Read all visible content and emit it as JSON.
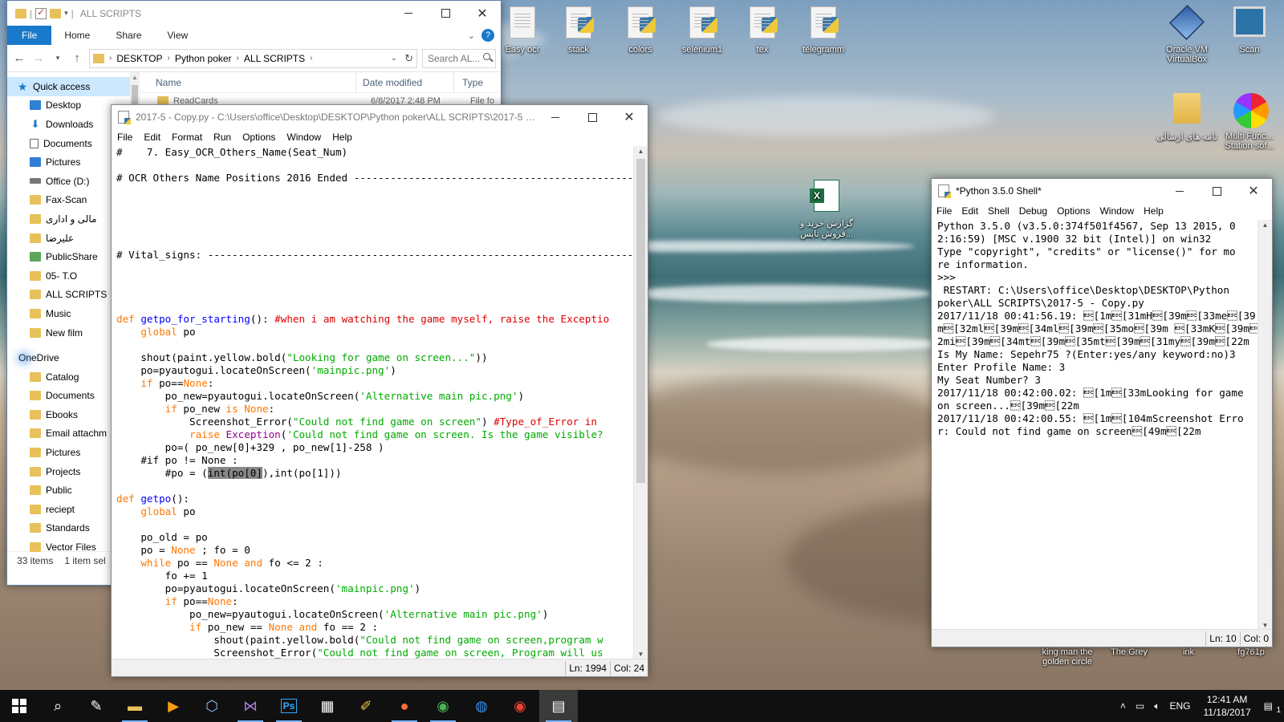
{
  "desktop": {
    "icons_top": [
      {
        "label": "Easy ocr"
      },
      {
        "label": "stack"
      },
      {
        "label": "colors"
      },
      {
        "label": "selenium1"
      },
      {
        "label": "tex"
      },
      {
        "label": "telegramm"
      }
    ],
    "icons_right": [
      {
        "label": "Oracle VM VirtualBox"
      },
      {
        "label": "Scan"
      },
      {
        "label": "نامه های ارسالی"
      },
      {
        "label": "Multi Func... Station sof..."
      }
    ],
    "excel_icon_label": "گزارش خرید و فروش تایس...",
    "bottom_labels": [
      "king man the golden circle",
      "The Grey",
      "ink",
      "fg761p"
    ]
  },
  "explorer": {
    "title": "ALL SCRIPTS",
    "tabs": [
      "File",
      "Home",
      "Share",
      "View"
    ],
    "breadcrumb": [
      "DESKTOP",
      "Python poker",
      "ALL SCRIPTS"
    ],
    "search_placeholder": "Search AL...",
    "columns": [
      "Name",
      "Date modified",
      "Type"
    ],
    "partial_row": {
      "name": "ReadCards",
      "date": "6/8/2017 2:48 PM",
      "type": "File fo"
    },
    "nav_items": [
      {
        "label": "Quick access",
        "icon": "star-icon"
      },
      {
        "label": "Desktop",
        "icon": "desktop-icon"
      },
      {
        "label": "Downloads",
        "icon": "download-icon"
      },
      {
        "label": "Documents",
        "icon": "document-icon"
      },
      {
        "label": "Pictures",
        "icon": "pictures-icon"
      },
      {
        "label": "Office (D:)",
        "icon": "drive-icon"
      },
      {
        "label": "Fax-Scan",
        "icon": "folder-icon"
      },
      {
        "label": "مالی و اداری",
        "icon": "folder-icon"
      },
      {
        "label": "علیرضا",
        "icon": "folder-icon"
      },
      {
        "label": "PublicShare",
        "icon": "shared-folder-icon"
      },
      {
        "label": "05- T.O",
        "icon": "folder-icon"
      },
      {
        "label": "ALL SCRIPTS",
        "icon": "folder-icon"
      },
      {
        "label": "Music",
        "icon": "folder-icon"
      },
      {
        "label": "New film",
        "icon": "folder-icon"
      },
      {
        "label": "OneDrive",
        "icon": "cloud-icon"
      },
      {
        "label": "Catalog",
        "icon": "folder-icon"
      },
      {
        "label": "Documents",
        "icon": "folder-icon"
      },
      {
        "label": "Ebooks",
        "icon": "folder-icon"
      },
      {
        "label": "Email attachm",
        "icon": "folder-icon"
      },
      {
        "label": "Pictures",
        "icon": "folder-icon"
      },
      {
        "label": "Projects",
        "icon": "folder-icon"
      },
      {
        "label": "Public",
        "icon": "folder-icon"
      },
      {
        "label": "reciept",
        "icon": "folder-icon"
      },
      {
        "label": "Standards",
        "icon": "folder-icon"
      },
      {
        "label": "Vector Files",
        "icon": "folder-icon"
      }
    ],
    "status_items": "33 items",
    "status_selected": "1 item sel"
  },
  "editor": {
    "title": "2017-5 - Copy.py - C:\\Users\\office\\Desktop\\DESKTOP\\Python poker\\ALL SCRIPTS\\2017-5 - C...",
    "menu": [
      "File",
      "Edit",
      "Format",
      "Run",
      "Options",
      "Window",
      "Help"
    ],
    "status_line": "Ln: 1994",
    "status_col": "Col: 24"
  },
  "shell": {
    "title": "*Python 3.5.0 Shell*",
    "menu": [
      "File",
      "Edit",
      "Shell",
      "Debug",
      "Options",
      "Window",
      "Help"
    ],
    "status_line": "Ln: 10",
    "status_col": "Col: 0",
    "lines": [
      {
        "text": "Python 3.5.0 (v3.5.0:374f501f4567, Sep 13 2015, 0",
        "style": "plain"
      },
      {
        "text": "2:16:59) [MSC v.1900 32 bit (Intel)] on win32",
        "style": "plain"
      },
      {
        "text": "Type \"copyright\", \"credits\" or \"license()\" for mo",
        "style": "plain"
      },
      {
        "text": "re information.",
        "style": "plain"
      },
      {
        "text": ">>> ",
        "style": "prompt"
      },
      {
        "text": " RESTART: C:\\Users\\office\\Desktop\\DESKTOP\\Python",
        "style": "plain"
      },
      {
        "text": "poker\\ALL SCRIPTS\\2017-5 - Copy.py",
        "style": "plain"
      },
      {
        "text": "2017/11/18 00:41:56.19: \u001b[1m\u001b[31mH\u001b[39m\u001b[33me\u001b[39",
        "style": "blue"
      },
      {
        "text": "m\u001b[32ml\u001b[39m\u001b[34ml\u001b[39m\u001b[35mo\u001b[39m \u001b[33mK\u001b[39m\u001b[3",
        "style": "blue"
      },
      {
        "text": "2mi\u001b[39m\u001b[34mt\u001b[39m\u001b[35mt\u001b[39m\u001b[31my\u001b[39m\u001b[22m",
        "style": "blue"
      },
      {
        "text": "Is My Name: Sepehr75 ?(Enter:yes/any keyword:no)3",
        "style": "blue"
      },
      {
        "text": "Enter Profile Name: 3",
        "style": "blue"
      },
      {
        "text": "My Seat Number? 3",
        "style": "blue"
      },
      {
        "text": "2017/11/18 00:42:00.02: \u001b[1m\u001b[33mLooking for game",
        "style": "blue"
      },
      {
        "text": "on screen...\u001b[39m\u001b[22m",
        "style": "blue"
      },
      {
        "text": "2017/11/18 00:42:00.55: \u001b[1m\u001b[104mScreenshot Erro",
        "style": "blue"
      },
      {
        "text": "r: Could not find game on screen\u001b[49m\u001b[22m",
        "style": "blue"
      }
    ]
  },
  "taskbar": {
    "apps": [
      {
        "icon": "search-icon"
      },
      {
        "icon": "paint-icon"
      },
      {
        "icon": "file-explorer-icon"
      },
      {
        "icon": "media-player-icon"
      },
      {
        "icon": "virtualbox-icon"
      },
      {
        "icon": "visual-studio-icon"
      },
      {
        "icon": "photoshop-icon"
      },
      {
        "icon": "calculator-icon"
      },
      {
        "icon": "sticky-tool-icon"
      },
      {
        "icon": "firefox-icon"
      },
      {
        "icon": "chrome-icon"
      },
      {
        "icon": "globe-app-icon"
      },
      {
        "icon": "chrome-alt-icon"
      },
      {
        "icon": "python-idle-icon"
      }
    ],
    "language": "ENG",
    "time": "12:41 AM",
    "date": "11/18/2017",
    "notification_count": "1"
  }
}
